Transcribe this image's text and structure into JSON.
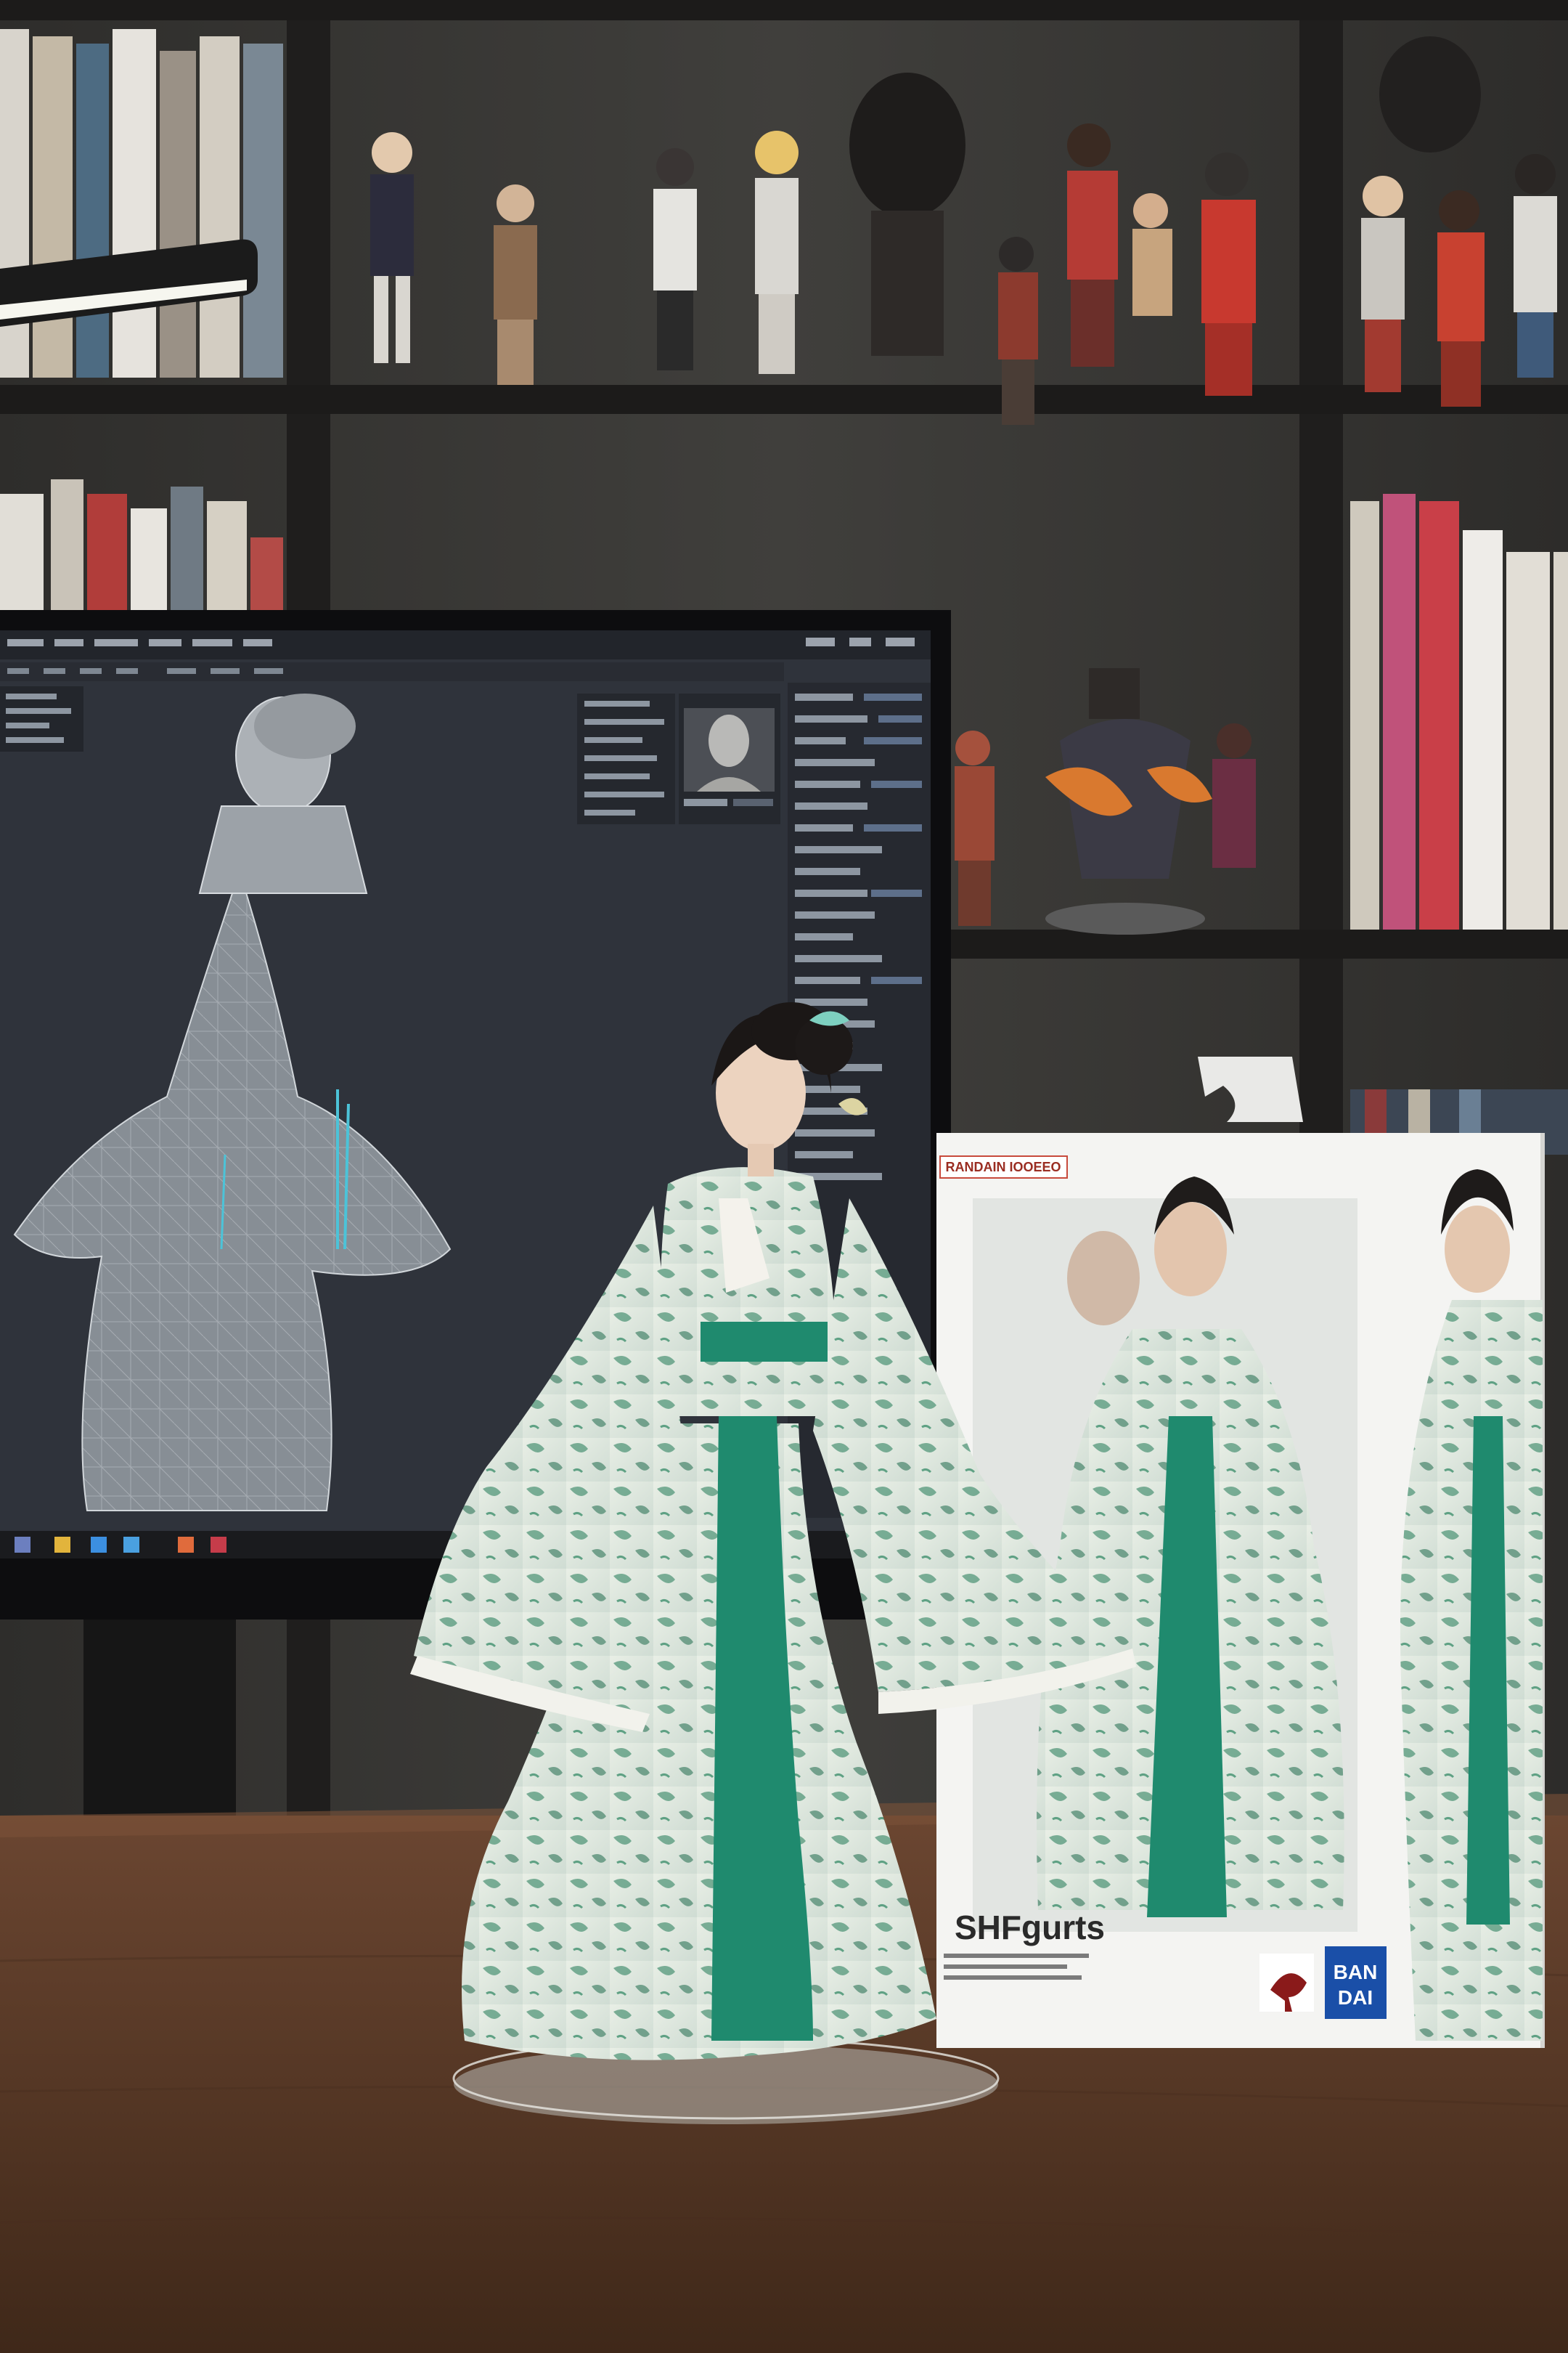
{
  "box": {
    "top_label": "RANDAIN IOOEEO",
    "brand": "SHFgurts",
    "maker_line1": "BAN",
    "maker_line2": "DAI"
  },
  "colors": {
    "wall": "#3a3937",
    "shelf": "#2a2826",
    "desk": "#5a3a28",
    "screen_bg": "#2f333b",
    "robe_green": "#1f8a6e",
    "box_white": "#f4f4f2",
    "bandai_blue": "#1a4fa8"
  }
}
